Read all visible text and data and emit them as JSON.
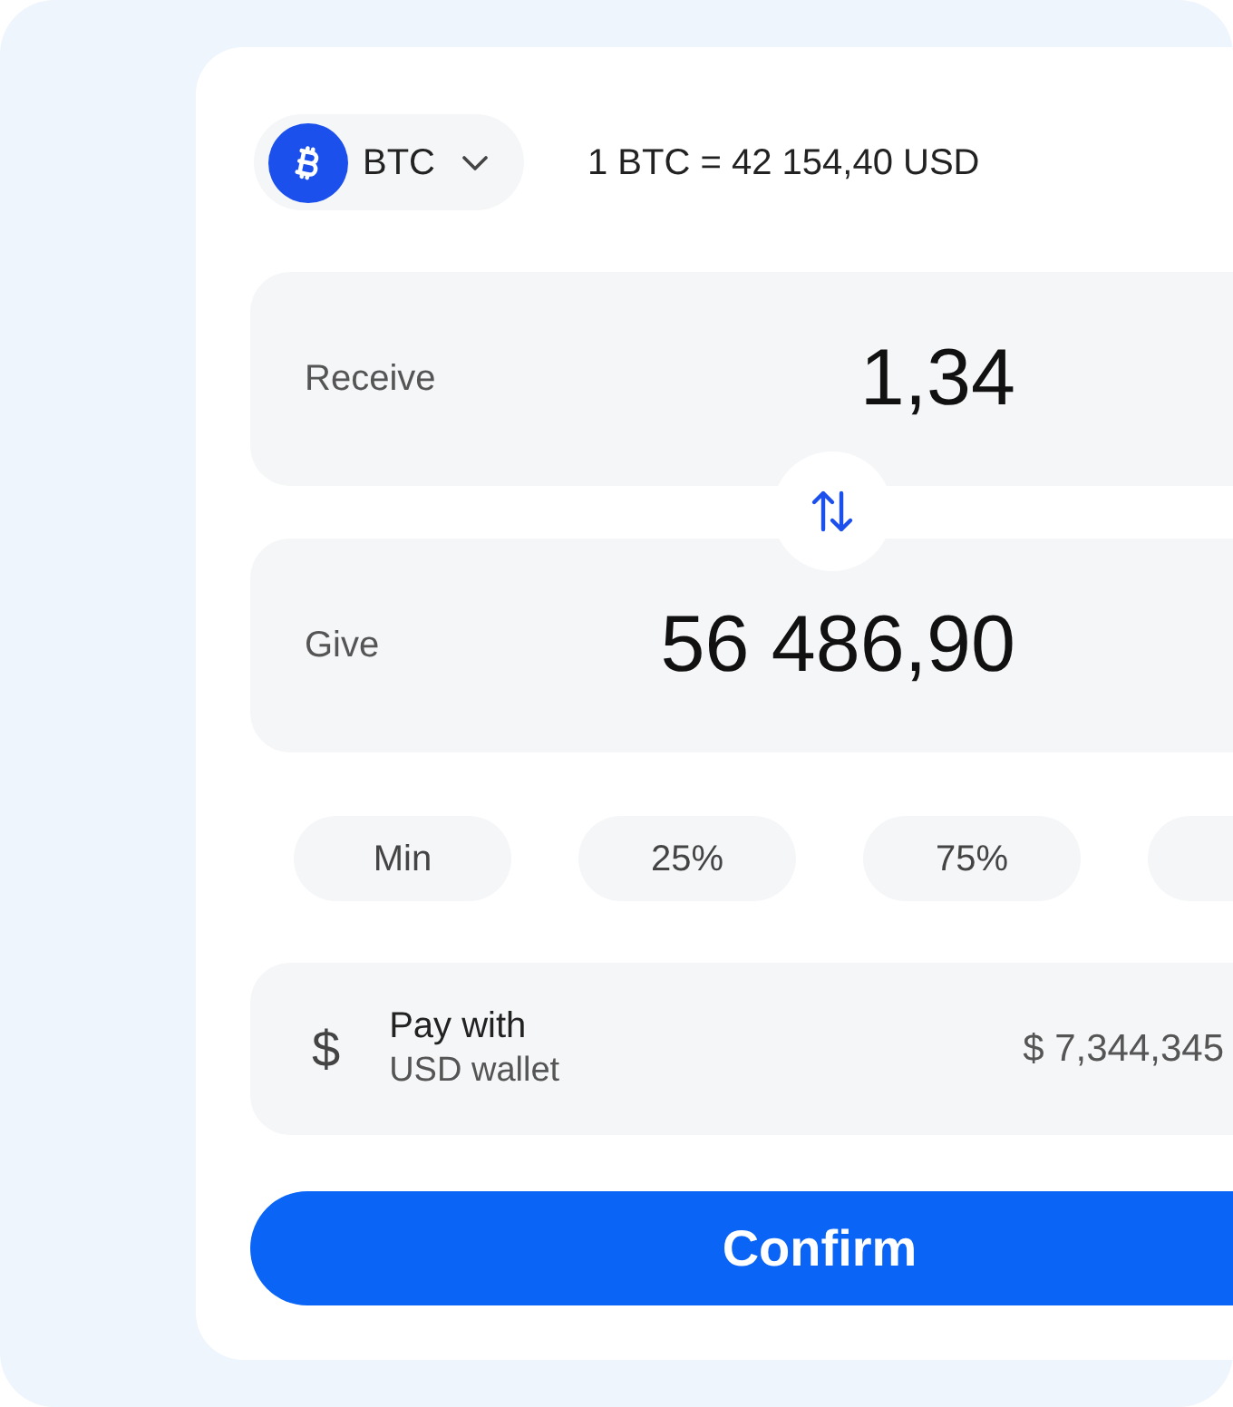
{
  "pair": {
    "coin_symbol": "BTC",
    "rate": "1 BTC = 42 154,40 USD"
  },
  "amounts": [
    {
      "label": "Receive",
      "value": "1,34"
    },
    {
      "label": "Give",
      "value": "56 486,90"
    }
  ],
  "amount_presets": [
    {
      "kind": "preset",
      "label": "Min"
    },
    {
      "kind": "preset",
      "label": "25%"
    },
    {
      "kind": "preset",
      "label": "75%"
    },
    {
      "kind": "clipped"
    }
  ],
  "payment": {
    "icon": "$",
    "title": "Pay with",
    "method": "USD wallet",
    "balance": "$ 7,344,345"
  },
  "confirm_button": {
    "label": "Confirm"
  }
}
